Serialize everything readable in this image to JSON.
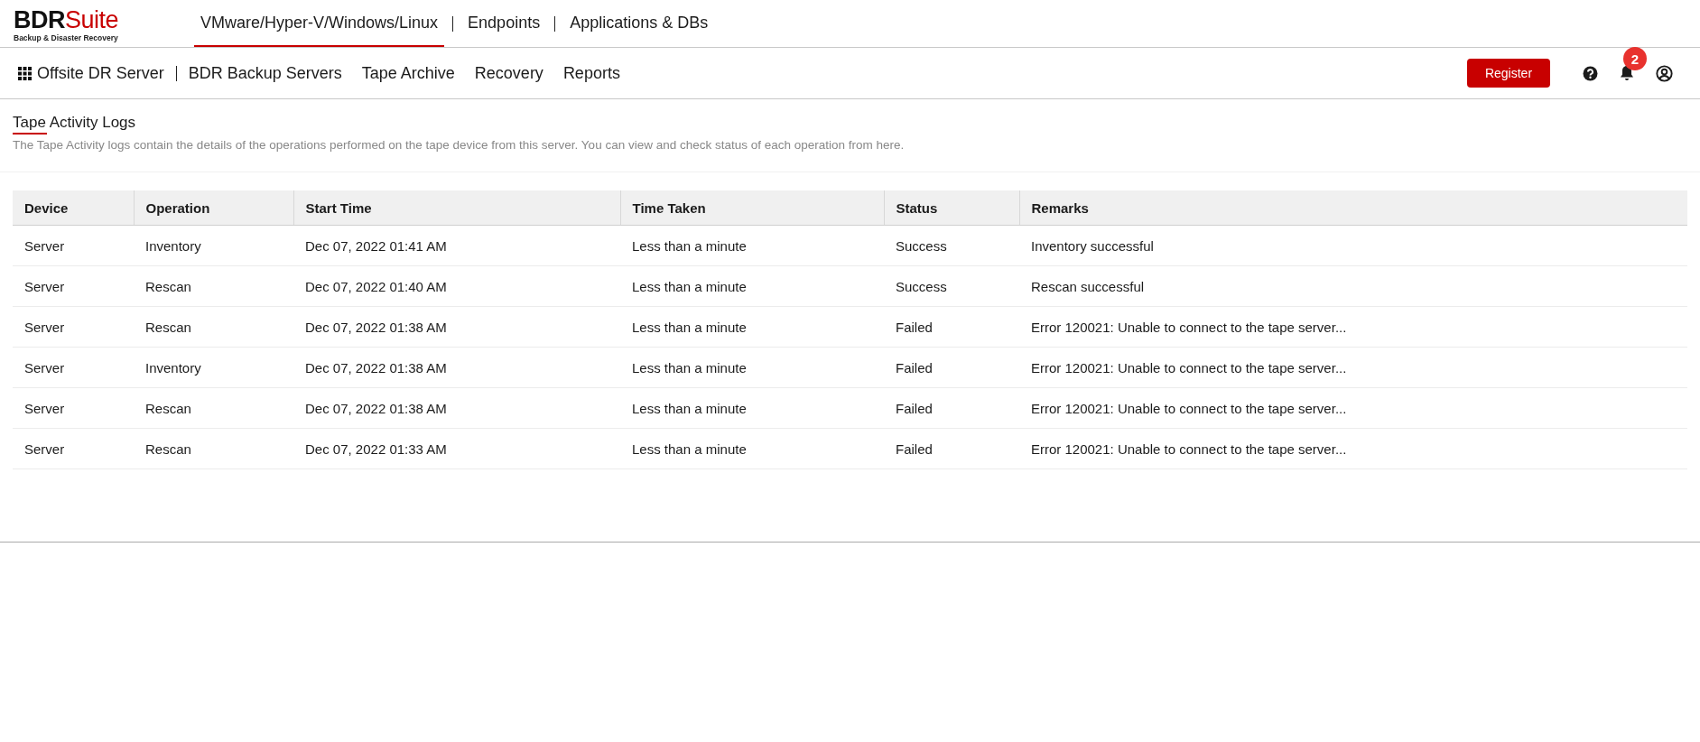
{
  "logo": {
    "name_dark": "BDR",
    "name_red": "Suite",
    "tagline": "Backup & Disaster Recovery"
  },
  "top_tabs": [
    {
      "label": "VMware/Hyper-V/Windows/Linux",
      "selected": true
    },
    {
      "label": "Endpoints",
      "selected": false
    },
    {
      "label": "Applications & DBs",
      "selected": false
    }
  ],
  "nav": {
    "product": "Offsite DR Server",
    "items": [
      "BDR Backup Servers",
      "Tape Archive",
      "Recovery",
      "Reports"
    ],
    "register": "Register",
    "notification_count": "2"
  },
  "page": {
    "title": "Tape Activity Logs",
    "description": "The Tape Activity logs contain the details of the operations performed on the tape device from this server. You can view and check status of each operation from here."
  },
  "table": {
    "columns": [
      "Device",
      "Operation",
      "Start Time",
      "Time Taken",
      "Status",
      "Remarks"
    ],
    "rows": [
      [
        "Server",
        "Inventory",
        "Dec 07, 2022 01:41 AM",
        "Less than a minute",
        "Success",
        "Inventory successful"
      ],
      [
        "Server",
        "Rescan",
        "Dec 07, 2022 01:40 AM",
        "Less than a minute",
        "Success",
        "Rescan successful"
      ],
      [
        "Server",
        "Rescan",
        "Dec 07, 2022 01:38 AM",
        "Less than a minute",
        "Failed",
        "Error 120021: Unable to connect to the tape server..."
      ],
      [
        "Server",
        "Inventory",
        "Dec 07, 2022 01:38 AM",
        "Less than a minute",
        "Failed",
        "Error 120021: Unable to connect to the tape server..."
      ],
      [
        "Server",
        "Rescan",
        "Dec 07, 2022 01:38 AM",
        "Less than a minute",
        "Failed",
        "Error 120021: Unable to connect to the tape server..."
      ],
      [
        "Server",
        "Rescan",
        "Dec 07, 2022 01:33 AM",
        "Less than a minute",
        "Failed",
        "Error 120021: Unable to connect to the tape server..."
      ]
    ]
  }
}
